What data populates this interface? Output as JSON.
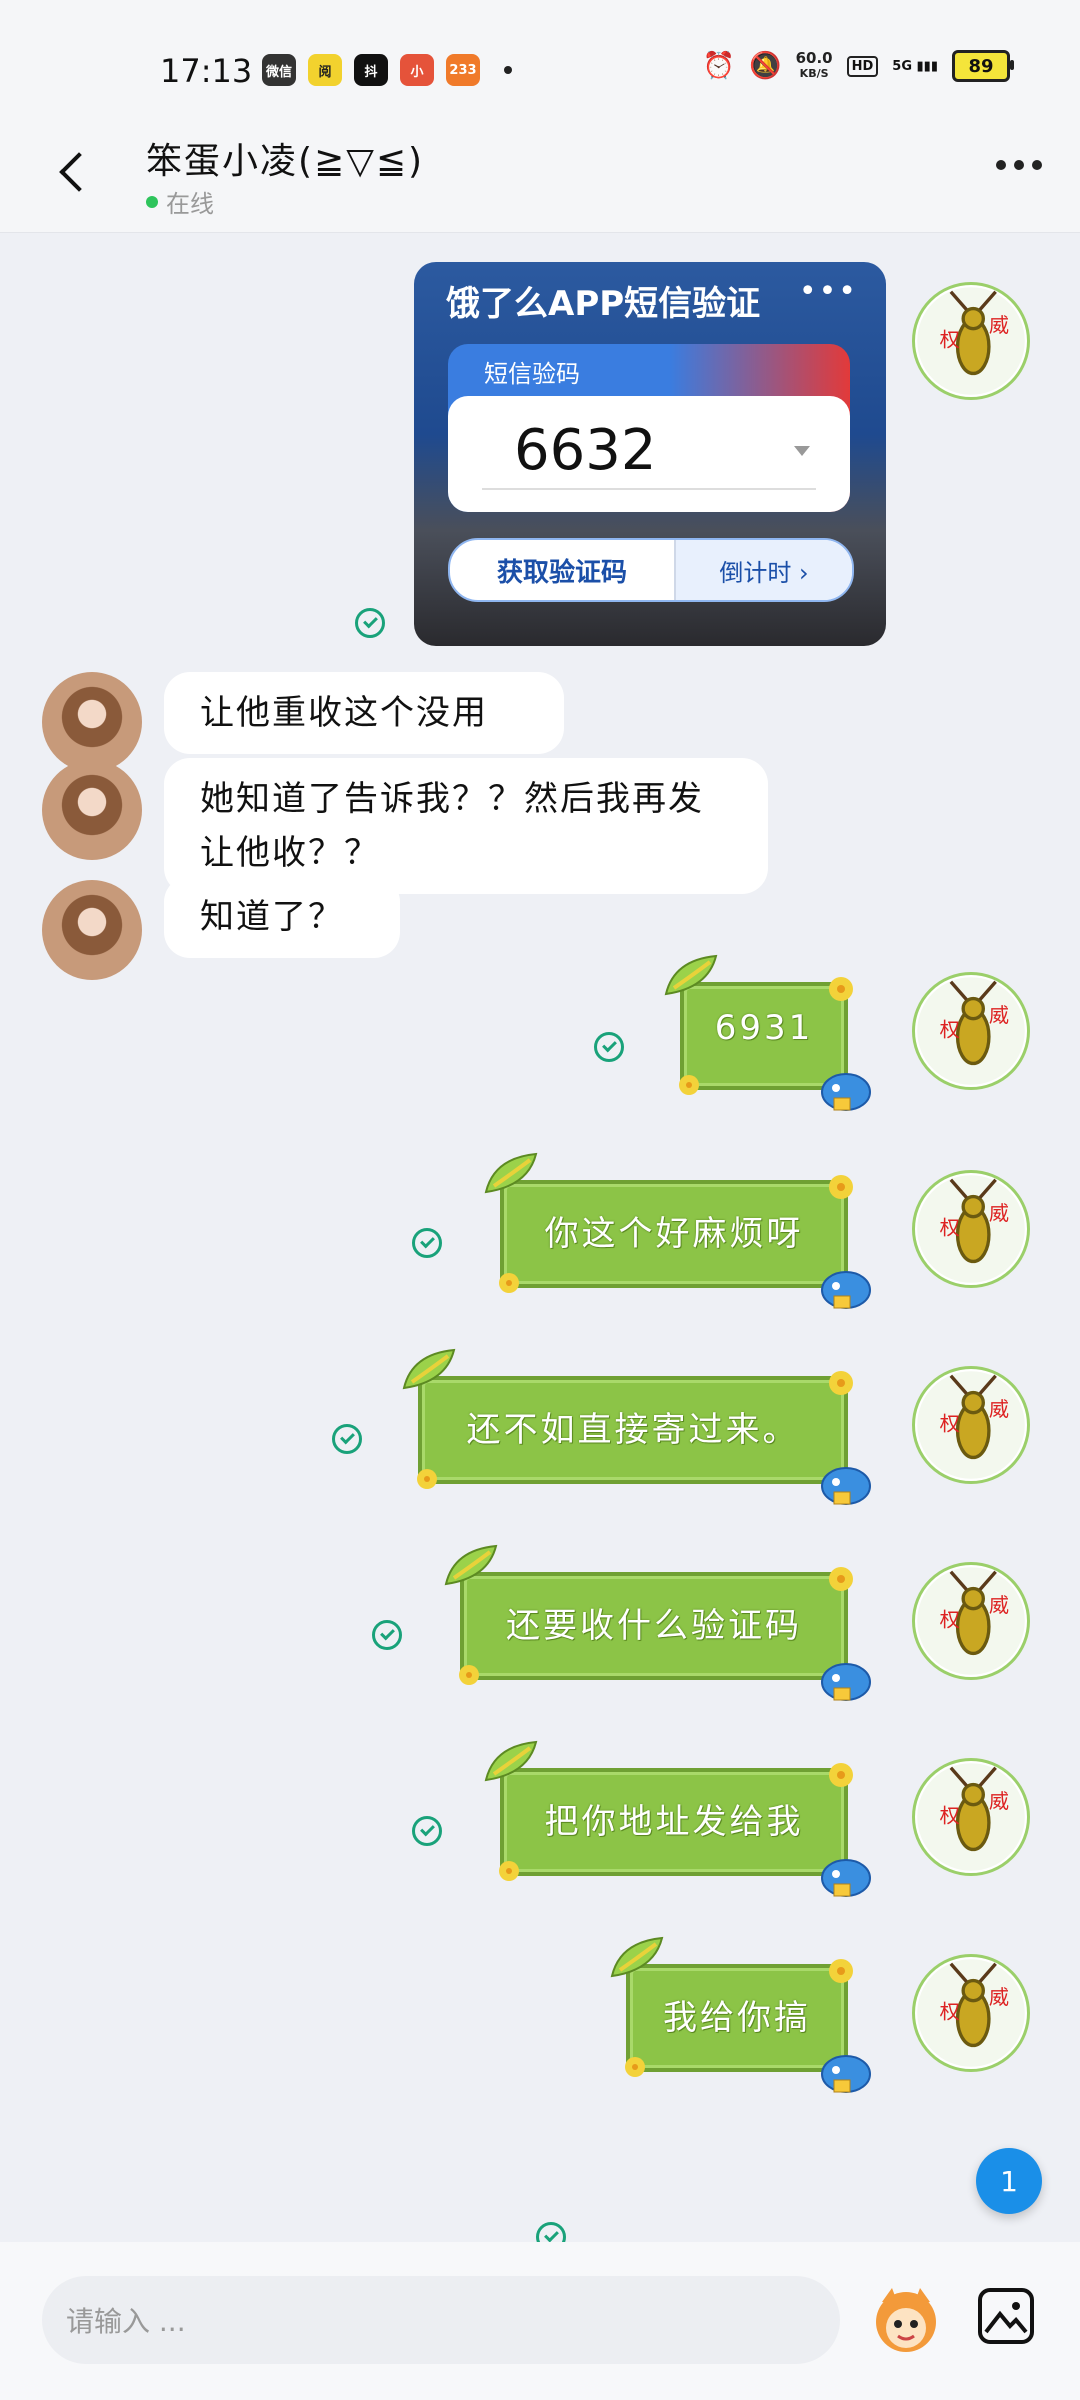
{
  "status_bar": {
    "time": "17:13",
    "apps": [
      "微信",
      "阅",
      "抖",
      "小",
      "233"
    ],
    "net_speed_value": "60.0",
    "net_speed_unit": "KB/S",
    "hd": "HD",
    "signal": "5G",
    "battery": "89"
  },
  "header": {
    "contact_name": "笨蛋小凌(≧▽≦)",
    "status": "在线"
  },
  "sms_card": {
    "title": "饿了么APP短信验证",
    "menu": "•••",
    "code_label": "短信验码",
    "code": "6632",
    "get_code": "获取验证码",
    "countdown": "倒计时 ›"
  },
  "peer_messages": [
    {
      "text": "让他重收这个没用"
    },
    {
      "text": "她知道了告诉我？？然后我再发让他收？？"
    },
    {
      "text": "知道了？"
    }
  ],
  "my_stickers": [
    {
      "text": "6931"
    },
    {
      "text": "你这个好麻烦呀"
    },
    {
      "text": "还不如直接寄过来。"
    },
    {
      "text": "还要收什么验证码"
    },
    {
      "text": "把你地址发给我"
    },
    {
      "text": "我给你搞"
    }
  ],
  "unread_badge": "1",
  "input": {
    "placeholder": "请输入 ..."
  },
  "colors": {
    "accent_green": "#19a27a",
    "online": "#2ec45c",
    "badge": "#1a8fe8",
    "sticker": "#8cc447"
  }
}
